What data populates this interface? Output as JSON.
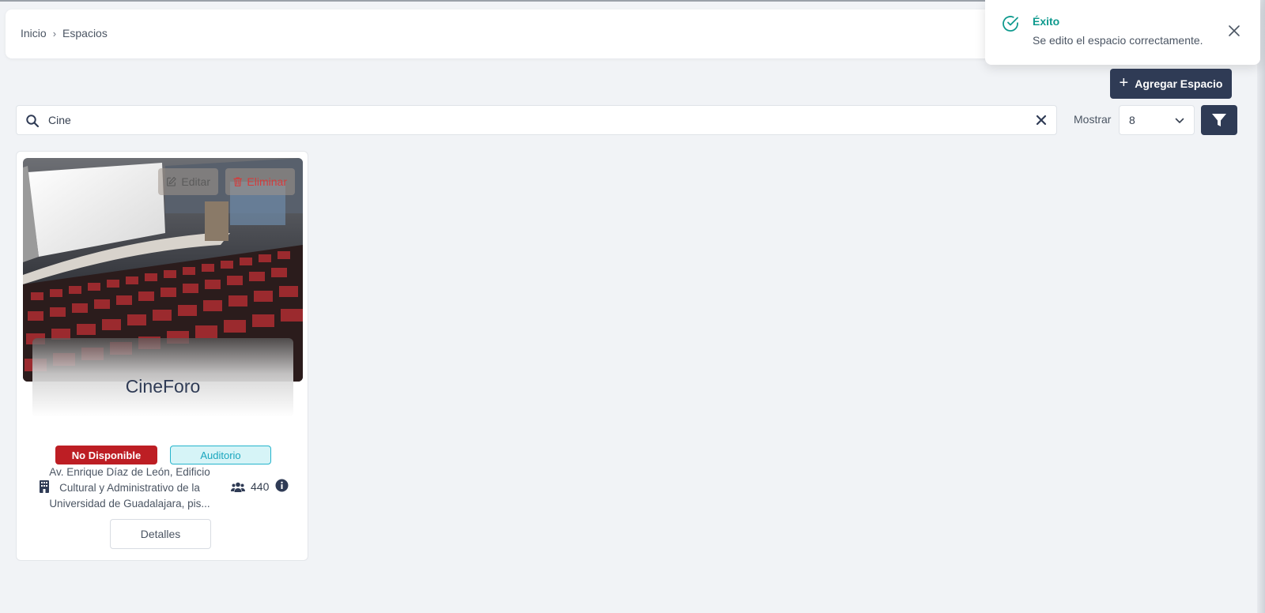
{
  "breadcrumb": {
    "home": "Inicio",
    "separator": "›",
    "current": "Espacios"
  },
  "toast": {
    "title": "Éxito",
    "message": "Se edito el espacio correctamente.",
    "accent_color": "#0f9a8e"
  },
  "toolbar": {
    "add_label": "Agregar Espacio",
    "search_value": "Cine",
    "show_label": "Mostrar",
    "show_value": "8"
  },
  "cards": [
    {
      "name": "CineForo",
      "edit_label": "Editar",
      "delete_label": "Eliminar",
      "status": "No Disponible",
      "type": "Auditorio",
      "address_lines": [
        "Av. Enrique Díaz de León, Edificio",
        "Cultural y Administrativo de la",
        "Universidad de Guadalajara, pis..."
      ],
      "capacity": "440",
      "details_label": "Detalles"
    }
  ],
  "colors": {
    "primary": "#2f3b55",
    "danger": "#bd1e24",
    "info": "#25b4cc",
    "background": "#f1f3f6"
  }
}
